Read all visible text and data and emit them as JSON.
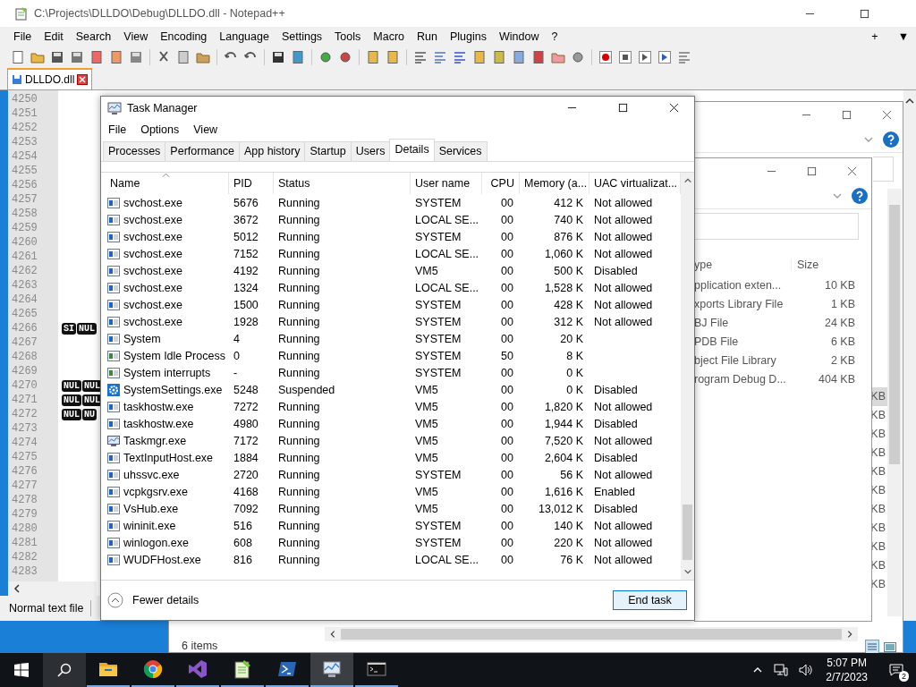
{
  "notepad": {
    "title": "C:\\Projects\\DLLDO\\Debug\\DLLDO.dll - Notepad++",
    "menu": [
      "File",
      "Edit",
      "Search",
      "View",
      "Encoding",
      "Language",
      "Settings",
      "Tools",
      "Macro",
      "Run",
      "Plugins",
      "Window",
      "?"
    ],
    "menu_right": [
      "+",
      "▼"
    ],
    "tabs": [
      {
        "label": "DLLDO.dll",
        "selected": true
      }
    ],
    "lines": [
      {
        "number": "4250"
      },
      {
        "number": "4251"
      },
      {
        "number": "4252"
      },
      {
        "number": "4253"
      },
      {
        "number": "4254"
      },
      {
        "number": "4255"
      },
      {
        "number": "4256"
      },
      {
        "number": "4257"
      },
      {
        "number": "4258"
      },
      {
        "number": "4259"
      },
      {
        "number": "4260"
      },
      {
        "number": "4261"
      },
      {
        "number": "4262"
      },
      {
        "number": "4263"
      },
      {
        "number": "4264"
      },
      {
        "number": "4265"
      },
      {
        "number": "4266",
        "tokens": [
          "SI",
          "NUL"
        ]
      },
      {
        "number": "4267"
      },
      {
        "number": "4268"
      },
      {
        "number": "4269"
      },
      {
        "number": "4270",
        "tokens": [
          "NUL",
          "NUL"
        ]
      },
      {
        "number": "4271",
        "tokens": [
          "NUL",
          "NUL"
        ]
      },
      {
        "number": "4272",
        "tokens": [
          "NUL",
          "NU"
        ]
      },
      {
        "number": "4273"
      },
      {
        "number": "4274"
      },
      {
        "number": "4275"
      },
      {
        "number": "4276"
      },
      {
        "number": "4277"
      },
      {
        "number": "4278"
      },
      {
        "number": "4279"
      },
      {
        "number": "4280"
      },
      {
        "number": "4281"
      },
      {
        "number": "4282"
      },
      {
        "number": "4283"
      }
    ],
    "status": "Normal text file"
  },
  "explorer_back": {
    "sizes": [
      "KB",
      "KB",
      "KB",
      "KB",
      "KB",
      "KB",
      "KB",
      "KB",
      "KB",
      "KB",
      "KB"
    ],
    "status": "6 items"
  },
  "explorer_front": {
    "columns": [
      "ype",
      "Size"
    ],
    "rows": [
      {
        "type": "pplication exten...",
        "size": "10 KB"
      },
      {
        "type": "xports Library File",
        "size": "1 KB"
      },
      {
        "type": "BJ File",
        "size": "24 KB"
      },
      {
        "type": "PDB File",
        "size": "6 KB"
      },
      {
        "type": "bject File Library",
        "size": "2 KB"
      },
      {
        "type": "rogram Debug D...",
        "size": "404 KB"
      }
    ]
  },
  "task_manager": {
    "title": "Task Manager",
    "menu": [
      "File",
      "Options",
      "View"
    ],
    "tabs": [
      {
        "label": "Processes",
        "selected": false
      },
      {
        "label": "Performance",
        "selected": false
      },
      {
        "label": "App history",
        "selected": false
      },
      {
        "label": "Startup",
        "selected": false
      },
      {
        "label": "Users",
        "selected": false
      },
      {
        "label": "Details",
        "selected": true
      },
      {
        "label": "Services",
        "selected": false
      }
    ],
    "columns": [
      "Name",
      "PID",
      "Status",
      "User name",
      "CPU",
      "Memory (a...",
      "UAC virtualizat..."
    ],
    "rows": [
      {
        "kind": "app",
        "cells": [
          "svchost.exe",
          "5676",
          "Running",
          "SYSTEM",
          "00",
          "412 K",
          "Not allowed"
        ]
      },
      {
        "kind": "app",
        "cells": [
          "svchost.exe",
          "3672",
          "Running",
          "LOCAL SE...",
          "00",
          "740 K",
          "Not allowed"
        ]
      },
      {
        "kind": "app",
        "cells": [
          "svchost.exe",
          "5012",
          "Running",
          "SYSTEM",
          "00",
          "876 K",
          "Not allowed"
        ]
      },
      {
        "kind": "app",
        "cells": [
          "svchost.exe",
          "7152",
          "Running",
          "LOCAL SE...",
          "00",
          "1,060 K",
          "Not allowed"
        ]
      },
      {
        "kind": "app",
        "cells": [
          "svchost.exe",
          "4192",
          "Running",
          "VM5",
          "00",
          "500 K",
          "Disabled"
        ]
      },
      {
        "kind": "app",
        "cells": [
          "svchost.exe",
          "1324",
          "Running",
          "LOCAL SE...",
          "00",
          "1,528 K",
          "Not allowed"
        ]
      },
      {
        "kind": "app",
        "cells": [
          "svchost.exe",
          "1500",
          "Running",
          "SYSTEM",
          "00",
          "428 K",
          "Not allowed"
        ]
      },
      {
        "kind": "app",
        "cells": [
          "svchost.exe",
          "1928",
          "Running",
          "SYSTEM",
          "00",
          "312 K",
          "Not allowed"
        ]
      },
      {
        "kind": "app",
        "cells": [
          "System",
          "4",
          "Running",
          "SYSTEM",
          "00",
          "20 K"
        ]
      },
      {
        "kind": "system",
        "cells": [
          "System Idle Process",
          "0",
          "Running",
          "SYSTEM",
          "50",
          "8 K"
        ]
      },
      {
        "kind": "system",
        "cells": [
          "System interrupts",
          "-",
          "Running",
          "SYSTEM",
          "00",
          "0 K"
        ]
      },
      {
        "kind": "settings",
        "cells": [
          "SystemSettings.exe",
          "5248",
          "Suspended",
          "VM5",
          "00",
          "0 K",
          "Disabled"
        ]
      },
      {
        "kind": "app",
        "cells": [
          "taskhostw.exe",
          "7272",
          "Running",
          "VM5",
          "00",
          "1,820 K",
          "Not allowed"
        ]
      },
      {
        "kind": "app",
        "cells": [
          "taskhostw.exe",
          "4980",
          "Running",
          "VM5",
          "00",
          "1,944 K",
          "Disabled"
        ]
      },
      {
        "kind": "monitor",
        "cells": [
          "Taskmgr.exe",
          "7172",
          "Running",
          "VM5",
          "00",
          "7,520 K",
          "Not allowed"
        ]
      },
      {
        "kind": "app",
        "cells": [
          "TextInputHost.exe",
          "1884",
          "Running",
          "VM5",
          "00",
          "2,604 K",
          "Disabled"
        ]
      },
      {
        "kind": "app",
        "cells": [
          "uhssvc.exe",
          "2720",
          "Running",
          "SYSTEM",
          "00",
          "56 K",
          "Not allowed"
        ]
      },
      {
        "kind": "app",
        "cells": [
          "vcpkgsrv.exe",
          "4168",
          "Running",
          "VM5",
          "00",
          "1,616 K",
          "Enabled"
        ]
      },
      {
        "kind": "app",
        "cells": [
          "VsHub.exe",
          "7092",
          "Running",
          "VM5",
          "00",
          "13,012 K",
          "Disabled"
        ]
      },
      {
        "kind": "app",
        "cells": [
          "wininit.exe",
          "516",
          "Running",
          "SYSTEM",
          "00",
          "140 K",
          "Not allowed"
        ]
      },
      {
        "kind": "app",
        "cells": [
          "winlogon.exe",
          "608",
          "Running",
          "SYSTEM",
          "00",
          "220 K",
          "Not allowed"
        ]
      },
      {
        "kind": "app",
        "cells": [
          "WUDFHost.exe",
          "816",
          "Running",
          "LOCAL SE...",
          "00",
          "76 K",
          "Not allowed"
        ]
      }
    ],
    "footer_toggle": "Fewer details",
    "button": "End task"
  },
  "taskbar": {
    "apps": [
      {
        "kind": "folder",
        "selected": false
      },
      {
        "kind": "browser",
        "selected": false
      },
      {
        "kind": "studio",
        "selected": false
      },
      {
        "kind": "notepad",
        "selected": false
      },
      {
        "kind": "shell",
        "selected": false
      },
      {
        "kind": "monitor",
        "selected": true
      },
      {
        "kind": "console",
        "selected": false
      }
    ],
    "time": "5:07 PM",
    "date": "2/7/2023",
    "notifications": "2"
  }
}
